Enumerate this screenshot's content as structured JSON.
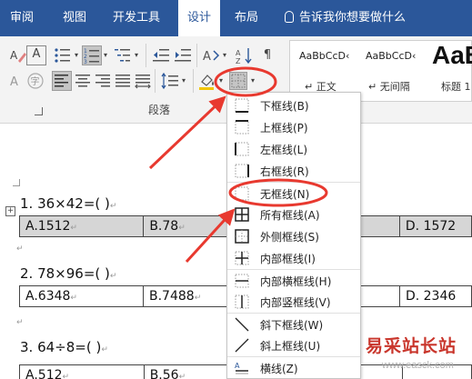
{
  "tabs": [
    {
      "label": "审阅",
      "active": false
    },
    {
      "label": "视图",
      "active": false
    },
    {
      "label": "开发工具",
      "active": false
    },
    {
      "label": "设计",
      "active": true
    },
    {
      "label": "布局",
      "active": false
    }
  ],
  "tell_me": "告诉我你想要做什么",
  "ribbon": {
    "group_label": "段落",
    "phonetic_glyph": "A",
    "enclose_glyph": "字",
    "styles": [
      {
        "preview": "AaBbCcD‹",
        "name": "↵ 正文"
      },
      {
        "preview": "AaBbCcD‹",
        "name": "↵ 无间隔"
      },
      {
        "preview": "AaB",
        "name": "标题 1"
      }
    ]
  },
  "document": {
    "q1": "1.  36×42=(         )",
    "q1_row": [
      "A.1512",
      "B.78",
      "D.  1572"
    ],
    "q2": "2.  78×96=(         )",
    "q2_row": [
      "A.6348",
      "B.7488",
      "D.  2346"
    ],
    "q3": "3.  64÷8=(         )",
    "q3_row": [
      "A.512",
      "B.56"
    ],
    "para_mark": "↵"
  },
  "border_menu": {
    "items": [
      {
        "label": "下框线(B)",
        "icon": "bottom-border-icon"
      },
      {
        "label": "上框线(P)",
        "icon": "top-border-icon"
      },
      {
        "label": "左框线(L)",
        "icon": "left-border-icon"
      },
      {
        "label": "右框线(R)",
        "icon": "right-border-icon"
      },
      {
        "label": "无框线(N)",
        "icon": "no-border-icon"
      },
      {
        "label": "所有框线(A)",
        "icon": "all-borders-icon"
      },
      {
        "label": "外侧框线(S)",
        "icon": "outside-borders-icon"
      },
      {
        "label": "内部框线(I)",
        "icon": "inside-borders-icon"
      },
      {
        "label": "内部横框线(H)",
        "icon": "inside-horizontal-border-icon"
      },
      {
        "label": "内部竖框线(V)",
        "icon": "inside-vertical-border-icon"
      },
      {
        "label": "斜下框线(W)",
        "icon": "diagonal-down-border-icon"
      },
      {
        "label": "斜上框线(U)",
        "icon": "diagonal-up-border-icon"
      },
      {
        "label": "横线(Z)",
        "icon": "horizontal-line-icon"
      }
    ]
  },
  "watermark": {
    "title": "易采站长站",
    "url": "www.easck.com"
  },
  "colors": {
    "tab_bar": "#2b579a",
    "highlight": "#e8392f",
    "table_shade": "#d6d6d6"
  }
}
